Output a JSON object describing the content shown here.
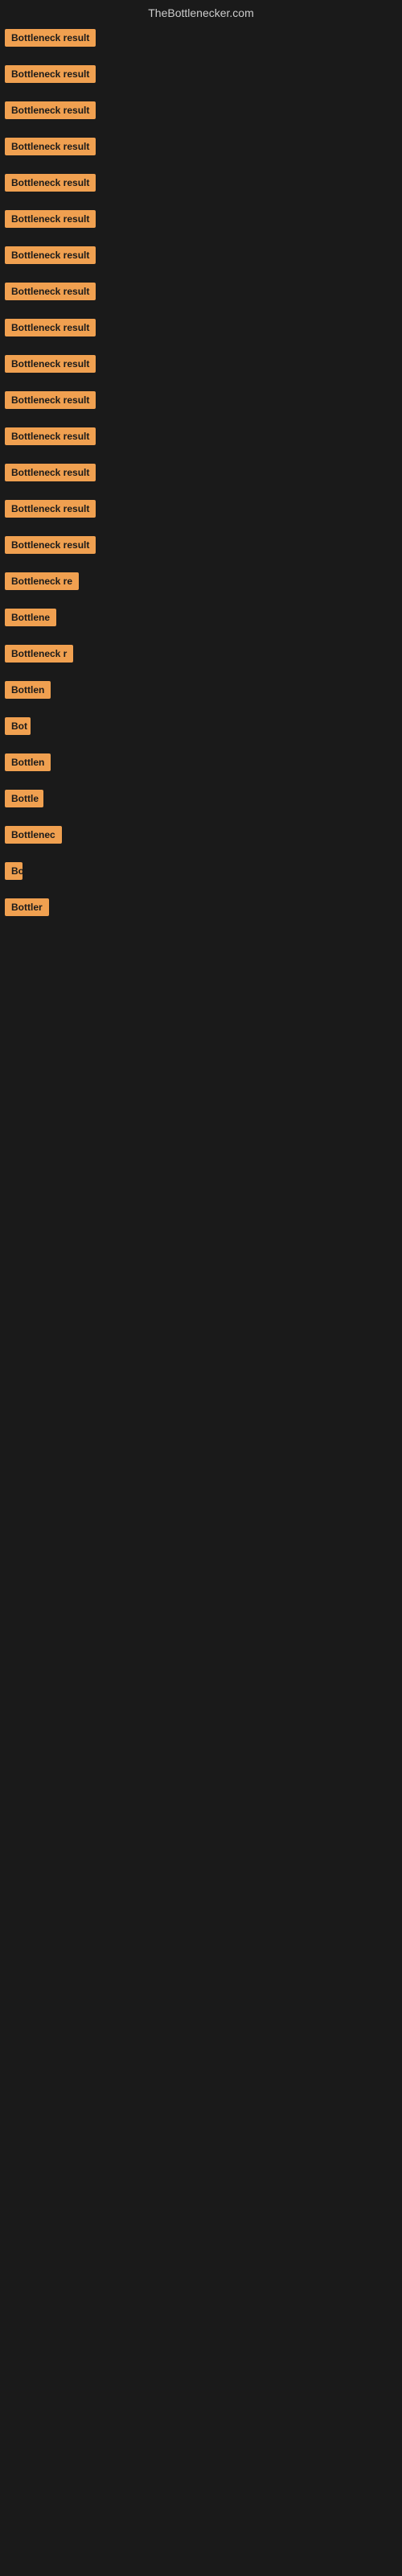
{
  "header": {
    "title": "TheBottlenecker.com"
  },
  "items": [
    {
      "label": "Bottleneck result",
      "width": "full"
    },
    {
      "label": "Bottleneck result",
      "width": "full"
    },
    {
      "label": "Bottleneck result",
      "width": "full"
    },
    {
      "label": "Bottleneck result",
      "width": "full"
    },
    {
      "label": "Bottleneck result",
      "width": "full"
    },
    {
      "label": "Bottleneck result",
      "width": "full"
    },
    {
      "label": "Bottleneck result",
      "width": "full"
    },
    {
      "label": "Bottleneck result",
      "width": "full"
    },
    {
      "label": "Bottleneck result",
      "width": "full"
    },
    {
      "label": "Bottleneck result",
      "width": "full"
    },
    {
      "label": "Bottleneck result",
      "width": "full"
    },
    {
      "label": "Bottleneck result",
      "width": "full"
    },
    {
      "label": "Bottleneck result",
      "width": "full"
    },
    {
      "label": "Bottleneck result",
      "width": "full"
    },
    {
      "label": "Bottleneck result",
      "width": "full"
    },
    {
      "label": "Bottleneck re",
      "width": "partial1"
    },
    {
      "label": "Bottlene",
      "width": "partial2"
    },
    {
      "label": "Bottleneck r",
      "width": "partial3"
    },
    {
      "label": "Bottlen",
      "width": "partial4"
    },
    {
      "label": "Bot",
      "width": "partial5"
    },
    {
      "label": "Bottlen",
      "width": "partial4"
    },
    {
      "label": "Bottle",
      "width": "partial6"
    },
    {
      "label": "Bottlenec",
      "width": "partial7"
    },
    {
      "label": "Bo",
      "width": "partial8"
    },
    {
      "label": "Bottler",
      "width": "partial9"
    }
  ],
  "badge_color": "#f0a050"
}
